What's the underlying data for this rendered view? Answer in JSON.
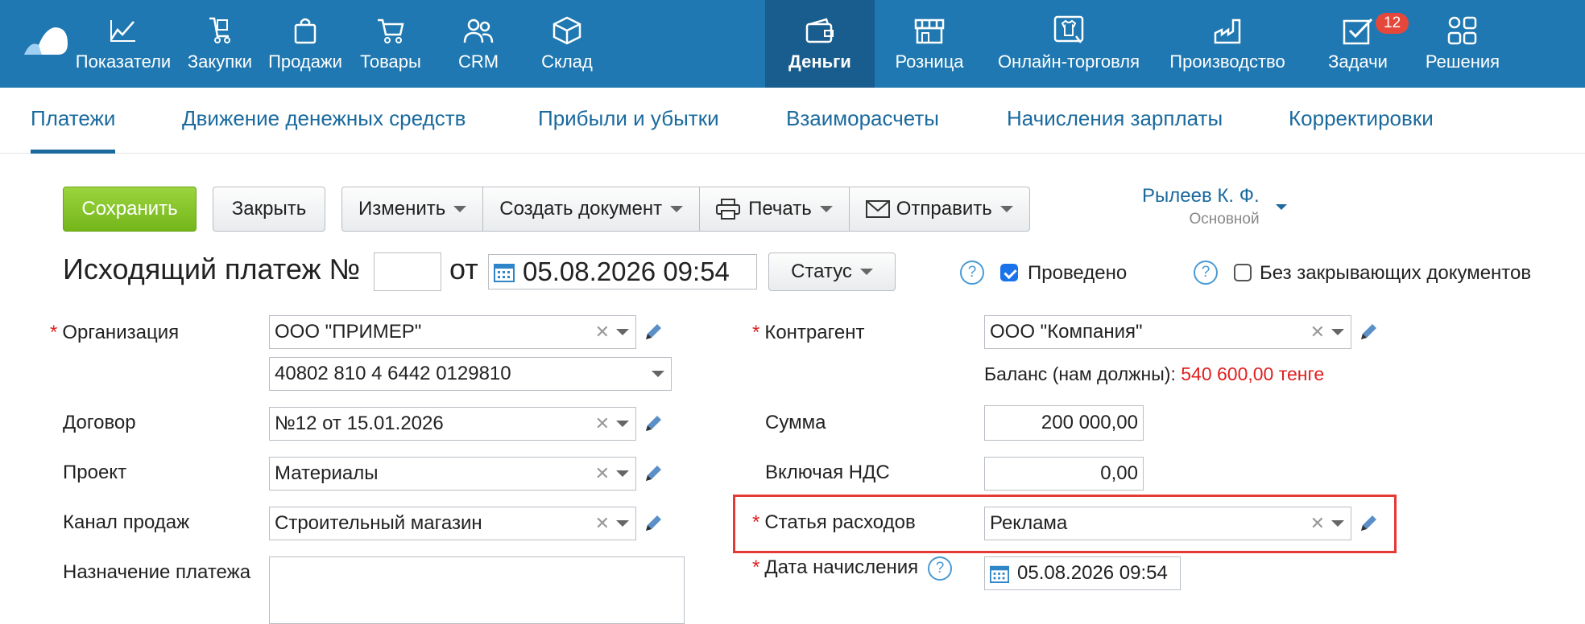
{
  "nav": {
    "items": [
      {
        "label": "Показатели",
        "icon": "chart-icon"
      },
      {
        "label": "Закупки",
        "icon": "cart-hand-icon"
      },
      {
        "label": "Продажи",
        "icon": "bag-icon"
      },
      {
        "label": "Товары",
        "icon": "shopping-cart-icon"
      },
      {
        "label": "CRM",
        "icon": "people-icon"
      },
      {
        "label": "Склад",
        "icon": "box-icon"
      },
      {
        "label": "Деньги",
        "icon": "wallet-icon",
        "active": true
      },
      {
        "label": "Розница",
        "icon": "store-icon"
      },
      {
        "label": "Онлайн-торговля",
        "icon": "shirt-icon"
      },
      {
        "label": "Производство",
        "icon": "factory-icon"
      },
      {
        "label": "Задачи",
        "icon": "check-icon",
        "badge": "12"
      },
      {
        "label": "Решения",
        "icon": "apps-icon"
      }
    ]
  },
  "tabs": [
    {
      "label": "Платежи",
      "active": true
    },
    {
      "label": "Движение денежных средств"
    },
    {
      "label": "Прибыли и убытки"
    },
    {
      "label": "Взаиморасчеты"
    },
    {
      "label": "Начисления зарплаты"
    },
    {
      "label": "Корректировки"
    }
  ],
  "toolbar": {
    "save": "Сохранить",
    "close": "Закрыть",
    "edit": "Изменить",
    "create_doc": "Создать документ",
    "print": "Печать",
    "send": "Отправить"
  },
  "user": {
    "name": "Рылеев К. Ф.",
    "role": "Основной"
  },
  "header": {
    "title": "Исходящий платеж №",
    "number": "",
    "from": "от",
    "date": "05.08.2026 09:54",
    "status": "Статус",
    "posted_label": "Проведено",
    "posted": true,
    "no_closing_label": "Без закрывающих документов",
    "no_closing": false
  },
  "form": {
    "organization_label": "Организация",
    "organization": "ООО \"ПРИМЕР\"",
    "account": "40802 810 4 6442 0129810",
    "contract_label": "Договор",
    "contract": "№12 от 15.01.2026",
    "project_label": "Проект",
    "project": "Материалы",
    "channel_label": "Канал продаж",
    "channel": "Строительный магазин",
    "purpose_label": "Назначение платежа",
    "purpose": "",
    "counterparty_label": "Контрагент",
    "counterparty": "ООО \"Компания\"",
    "balance_label": "Баланс (нам должны):",
    "balance_value": "540 600,00 тенге",
    "sum_label": "Сумма",
    "sum": "200 000,00",
    "vat_label": "Включая НДС",
    "vat": "0,00",
    "expense_label": "Статья расходов",
    "expense": "Реклама",
    "accrual_label": "Дата начисления",
    "accrual_date": "05.08.2026 09:54"
  },
  "colors": {
    "topbar": "#1f78b1",
    "active_nav": "#185d8d",
    "link": "#1a6a9e",
    "save": "#84c22a",
    "error": "#e02020"
  }
}
